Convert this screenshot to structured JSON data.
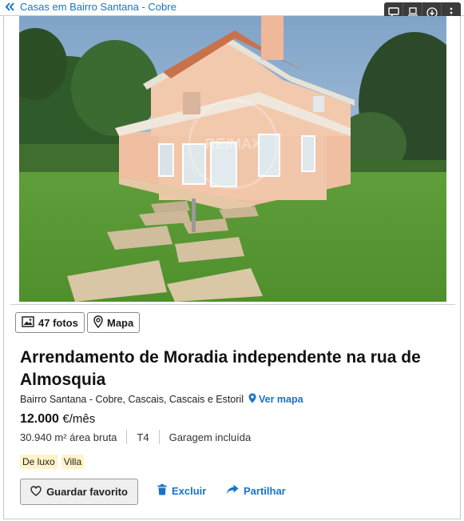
{
  "breadcrumb": {
    "label": "Casas em Bairro Santana - Cobre"
  },
  "toolbar": {
    "icons": [
      "comment-icon",
      "reader-icon",
      "download-icon",
      "more-icon"
    ]
  },
  "photo": {
    "watermark": "RE/MAX"
  },
  "media": {
    "photos_label": "47 fotos",
    "map_label": "Mapa"
  },
  "listing": {
    "title": "Arrendamento de Moradia independente na rua de Almosquia",
    "location": "Bairro Santana - Cobre, Cascais, Cascais e Estoril",
    "map_link": "Ver mapa",
    "price": "12.000",
    "price_unit": "€/mês",
    "specs": {
      "area": "30.940 m² área bruta",
      "typology": "T4",
      "garage": "Garagem incluída"
    },
    "tags": [
      "De luxo",
      "Villa"
    ]
  },
  "actions": {
    "favorite": "Guardar favorito",
    "delete": "Excluir",
    "share": "Partilhar"
  },
  "colors": {
    "link": "#1a73c8",
    "tag_background": "#fff3c7",
    "toolbar": "#3b3b3b"
  }
}
